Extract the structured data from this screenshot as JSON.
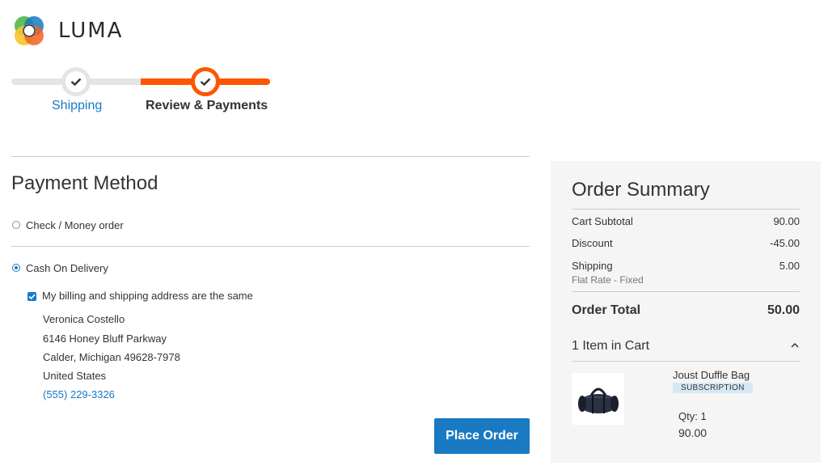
{
  "brand": {
    "name": "LUMA",
    "colors": [
      "#f26322",
      "#f8c32c",
      "#4fb848",
      "#1979c3"
    ]
  },
  "progress": {
    "steps": [
      {
        "label": "Shipping",
        "state": "complete"
      },
      {
        "label": "Review & Payments",
        "state": "active"
      }
    ],
    "accent": "#ff5501"
  },
  "payment": {
    "title": "Payment Method",
    "options": [
      {
        "label": "Check / Money order",
        "selected": false
      },
      {
        "label": "Cash On Delivery",
        "selected": true
      }
    ],
    "same_address_label": "My billing and shipping address are the same",
    "same_address_checked": true,
    "address": {
      "name": "Veronica Costello",
      "street": "6146 Honey Bluff Parkway",
      "city_line": "Calder, Michigan 49628-7978",
      "country": "United States",
      "phone": "(555) 229-3326"
    },
    "place_order_label": "Place Order"
  },
  "summary": {
    "title": "Order Summary",
    "rows": [
      {
        "label": "Cart Subtotal",
        "value": "90.00"
      },
      {
        "label": "Discount",
        "value": "-45.00"
      },
      {
        "label": "Shipping",
        "value": "5.00",
        "sub": "Flat Rate - Fixed"
      }
    ],
    "total_label": "Order Total",
    "total_value": "50.00",
    "items_title": "1 Item in Cart",
    "item": {
      "name": "Joust Duffle Bag",
      "badge": "SUBSCRIPTION",
      "qty": "Qty: 1",
      "price": "90.00"
    }
  },
  "icons": {
    "logo": "luma-logo-icon",
    "step_check": "checkmark-icon",
    "collapse": "chevron-up-icon",
    "checkbox": "checkbox-checked-icon"
  }
}
